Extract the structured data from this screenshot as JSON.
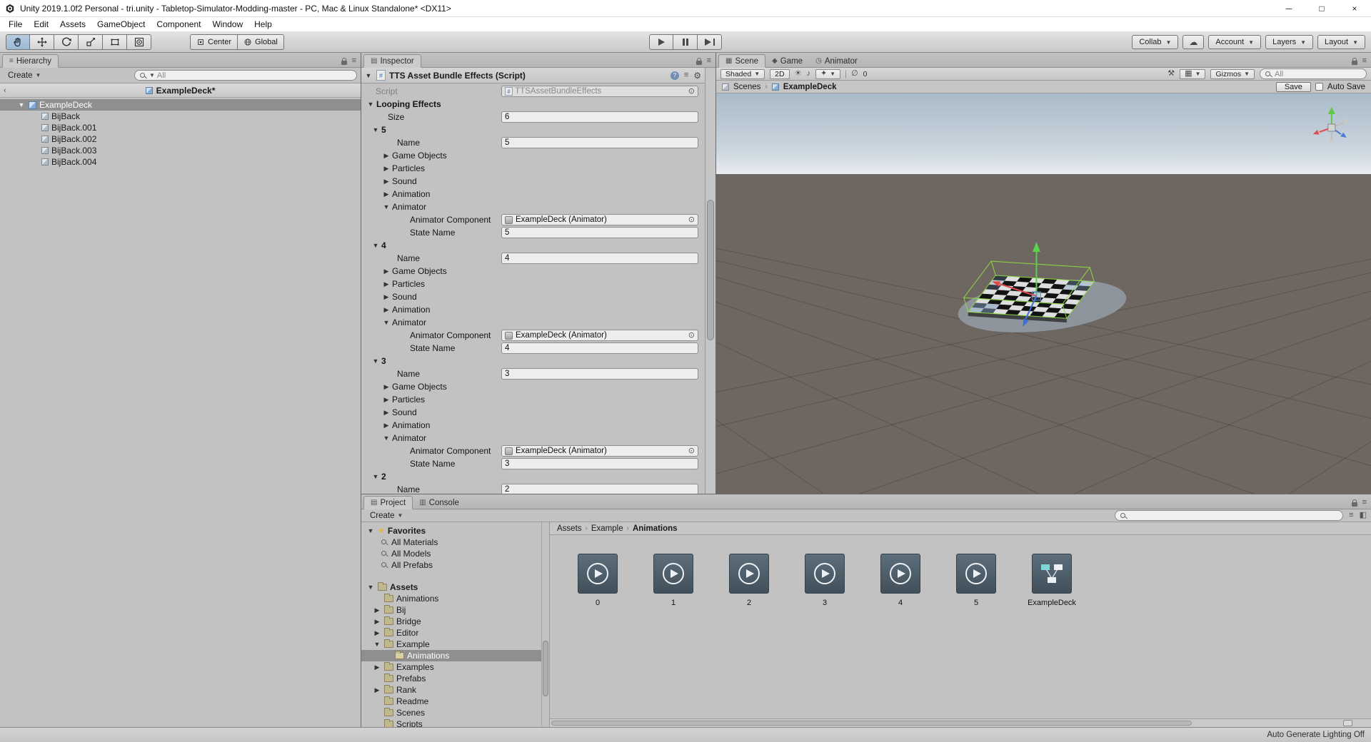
{
  "titlebar": {
    "title": "Unity 2019.1.0f2 Personal - tri.unity - Tabletop-Simulator-Modding-master - PC, Mac & Linux Standalone* <DX11>"
  },
  "menubar": {
    "items": [
      "File",
      "Edit",
      "Assets",
      "GameObject",
      "Component",
      "Window",
      "Help"
    ]
  },
  "toolbar": {
    "pivot_center": "Center",
    "pivot_global": "Global",
    "collab": "Collab",
    "account": "Account",
    "layers": "Layers",
    "layout": "Layout"
  },
  "hierarchy": {
    "tab": "Hierarchy",
    "create_label": "Create",
    "search_text": "All",
    "scene_header": "ExampleDeck*",
    "root_item": "ExampleDeck",
    "children": [
      "BijBack",
      "BijBack.001",
      "BijBack.002",
      "BijBack.003",
      "BijBack.004"
    ]
  },
  "inspector": {
    "tab": "Inspector",
    "header": "TTS Asset Bundle Effects (Script)",
    "script_label": "Script",
    "script_value": "TTSAssetBundleEffects",
    "looping_label": "Looping Effects",
    "size_label": "Size",
    "size_value": "6",
    "row_labels": {
      "name": "Name",
      "game_objects": "Game Objects",
      "particles": "Particles",
      "sound": "Sound",
      "animation": "Animation",
      "animator": "Animator",
      "animator_component": "Animator Component",
      "state_name": "State Name"
    },
    "elements": [
      {
        "index": "5",
        "name": "5",
        "animator_component": "ExampleDeck (Animator)",
        "state_name": "5"
      },
      {
        "index": "4",
        "name": "4",
        "animator_component": "ExampleDeck (Animator)",
        "state_name": "4"
      },
      {
        "index": "3",
        "name": "3",
        "animator_component": "ExampleDeck (Animator)",
        "state_name": "3"
      },
      {
        "index": "2",
        "name": "2"
      }
    ]
  },
  "scene": {
    "tab_scene": "Scene",
    "tab_game": "Game",
    "tab_animator": "Animator",
    "shading_mode": "Shaded",
    "mode_2d": "2D",
    "hidden_count": "0",
    "gizmos_label": "Gizmos",
    "search_text": "All",
    "breadcrumb_scenes": "Scenes",
    "breadcrumb_current": "ExampleDeck",
    "save_label": "Save",
    "autosave_label": "Auto Save"
  },
  "project": {
    "tab_project": "Project",
    "tab_console": "Console",
    "create_label": "Create",
    "favorites_label": "Favorites",
    "favorites": [
      "All Materials",
      "All Models",
      "All Prefabs"
    ],
    "assets_label": "Assets",
    "tree": [
      "Animations",
      "Bij",
      "Bridge",
      "Editor",
      "Example",
      "Animations",
      "Examples",
      "Prefabs",
      "Rank",
      "Readme",
      "Scenes",
      "Scripts"
    ],
    "breadcrumb": [
      "Assets",
      "Example",
      "Animations"
    ],
    "items": [
      "0",
      "1",
      "2",
      "3",
      "4",
      "5",
      "ExampleDeck"
    ]
  },
  "statusbar": {
    "right": "Auto Generate Lighting Off"
  }
}
